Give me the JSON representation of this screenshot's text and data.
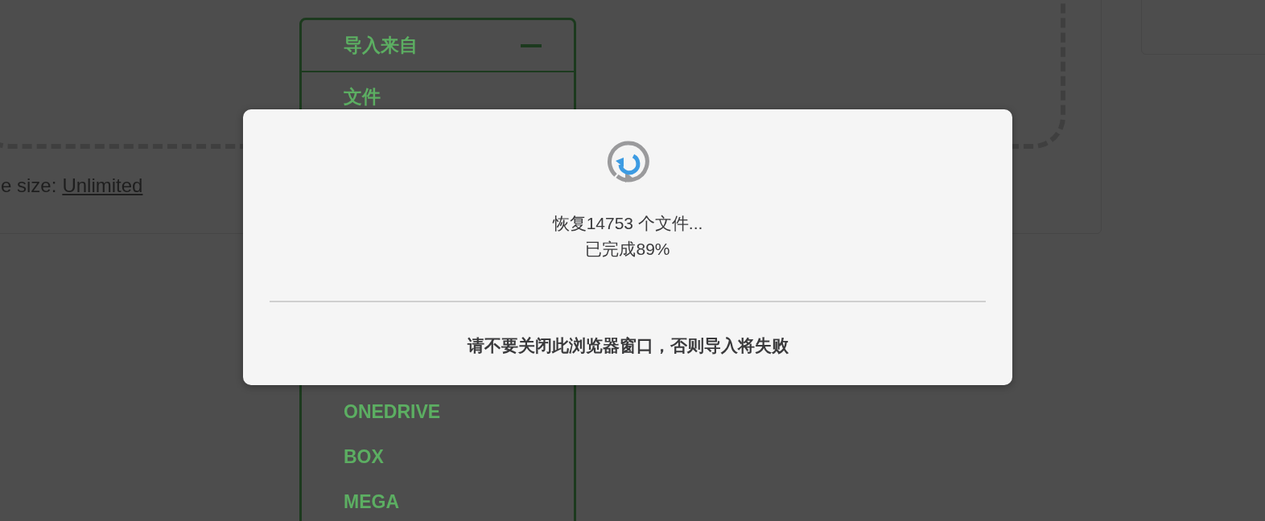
{
  "upload_card": {
    "size_label": "e size:",
    "size_value": "Unlimited"
  },
  "import_menu": {
    "title": "导入来自",
    "expanded": true,
    "items": [
      {
        "label": "文件"
      },
      {
        "label": "ONEDRIVE"
      },
      {
        "label": "BOX"
      },
      {
        "label": "MEGA"
      }
    ]
  },
  "dialog": {
    "status": "恢复14753 个文件...",
    "progress": "已完成89%",
    "warning": "请不要关闭此浏览器窗口，否则导入将失败"
  }
}
